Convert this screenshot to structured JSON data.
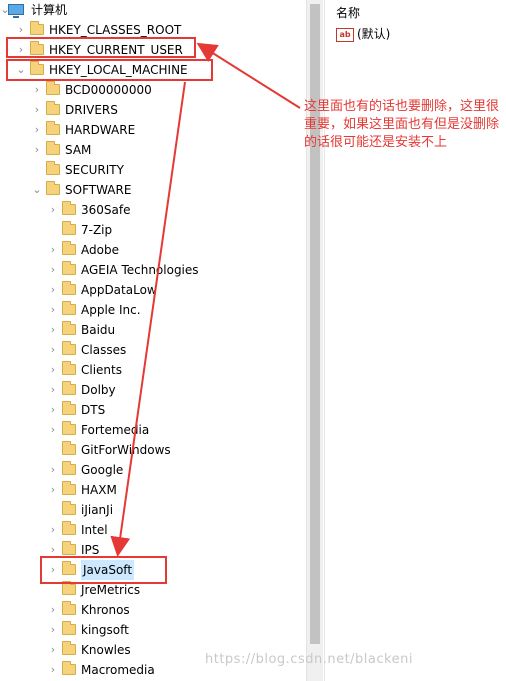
{
  "tree": {
    "root_label": "计算机",
    "hives": [
      {
        "label": "HKEY_CLASSES_ROOT",
        "arrow": "›"
      },
      {
        "label": "HKEY_CURRENT_USER",
        "arrow": "›"
      },
      {
        "label": "HKEY_LOCAL_MACHINE",
        "arrow": "⌄"
      }
    ],
    "hklm_children": [
      {
        "label": "BCD00000000",
        "arrow": "›"
      },
      {
        "label": "DRIVERS",
        "arrow": "›"
      },
      {
        "label": "HARDWARE",
        "arrow": "›"
      },
      {
        "label": "SAM",
        "arrow": "›"
      },
      {
        "label": "SECURITY",
        "arrow": ""
      },
      {
        "label": "SOFTWARE",
        "arrow": "⌄"
      }
    ],
    "software_children": [
      {
        "label": "360Safe",
        "arrow": "›"
      },
      {
        "label": "7-Zip",
        "arrow": ""
      },
      {
        "label": "Adobe",
        "arrow": "›"
      },
      {
        "label": "AGEIA Technologies",
        "arrow": "›"
      },
      {
        "label": "AppDataLow",
        "arrow": "›"
      },
      {
        "label": "Apple Inc.",
        "arrow": "›"
      },
      {
        "label": "Baidu",
        "arrow": "›"
      },
      {
        "label": "Classes",
        "arrow": "›"
      },
      {
        "label": "Clients",
        "arrow": "›"
      },
      {
        "label": "Dolby",
        "arrow": "›"
      },
      {
        "label": "DTS",
        "arrow": "›"
      },
      {
        "label": "Fortemedia",
        "arrow": "›"
      },
      {
        "label": "GitForWindows",
        "arrow": ""
      },
      {
        "label": "Google",
        "arrow": "›"
      },
      {
        "label": "HAXM",
        "arrow": "›"
      },
      {
        "label": "iJianJi",
        "arrow": ""
      },
      {
        "label": "Intel",
        "arrow": "›"
      },
      {
        "label": "IPS",
        "arrow": "›"
      },
      {
        "label": "JavaSoft",
        "arrow": "›"
      },
      {
        "label": "JreMetrics",
        "arrow": ""
      },
      {
        "label": "Khronos",
        "arrow": "›"
      },
      {
        "label": "kingsoft",
        "arrow": "›"
      },
      {
        "label": "Knowles",
        "arrow": "›"
      },
      {
        "label": "Macromedia",
        "arrow": "›"
      }
    ]
  },
  "values_pane": {
    "column_header": "名称",
    "default_value_name": "(默认)",
    "value_icon_text": "ab"
  },
  "annotation": {
    "text": "这里面也有的话也要删除，这里很重要，如果这里面也有但是没删除的话很可能还是安装不上",
    "color": "#e53935"
  },
  "watermark": "https://blog.csdn.net/blackeni"
}
